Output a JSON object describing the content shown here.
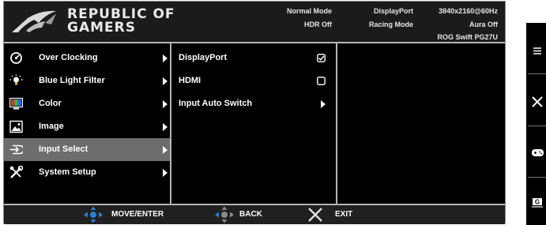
{
  "brand": {
    "line1": "REPUBLIC OF",
    "line2": "GAMERS"
  },
  "status": {
    "mode": "Normal Mode",
    "hdr": "HDR Off",
    "input": "DisplayPort",
    "preset": "Racing Mode",
    "resolution": "3840x2160@60Hz",
    "aura": "Aura Off",
    "model": "ROG Swift PG27U"
  },
  "menu": [
    {
      "label": "Over Clocking",
      "icon": "speedometer-icon"
    },
    {
      "label": "Blue Light Filter",
      "icon": "sun-bulb-icon"
    },
    {
      "label": "Color",
      "icon": "color-monitor-icon"
    },
    {
      "label": "Image",
      "icon": "image-icon"
    },
    {
      "label": "Input Select",
      "icon": "input-arrow-icon",
      "selected": true
    },
    {
      "label": "System Setup",
      "icon": "tools-icon"
    }
  ],
  "submenu": [
    {
      "label": "DisplayPort",
      "control": "checked"
    },
    {
      "label": "HDMI",
      "control": "unchecked"
    },
    {
      "label": "Input Auto Switch",
      "control": "arrow"
    }
  ],
  "footer": {
    "move": "MOVE/ENTER",
    "back": "BACK",
    "exit": "EXIT"
  },
  "colors": {
    "accent_blue": "#2a7fd4",
    "exit_x": "#e0e0e0",
    "selected_row": "#6d6d6d"
  }
}
